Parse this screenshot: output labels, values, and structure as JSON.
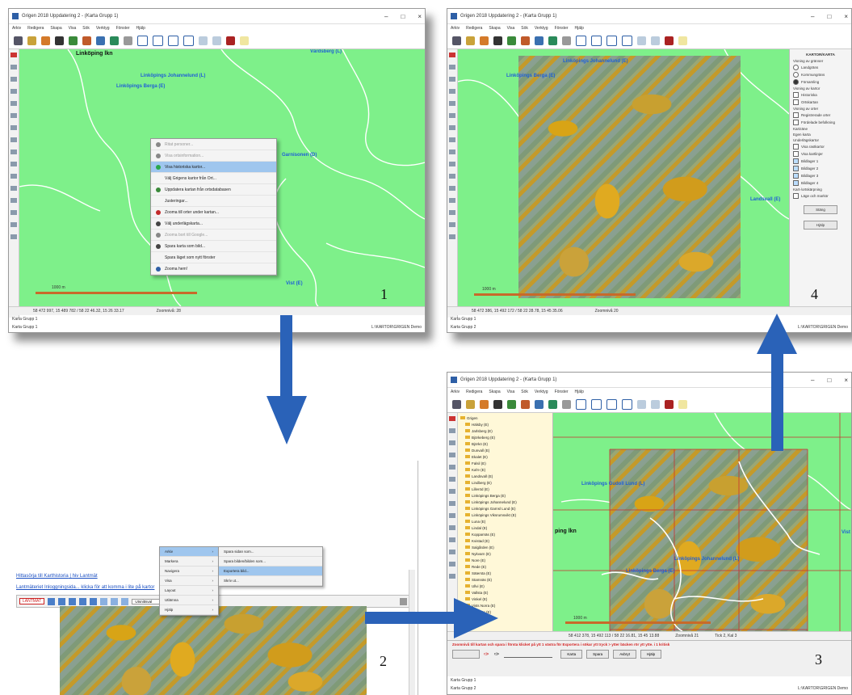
{
  "step_numbers": [
    "1",
    "2",
    "3",
    "4"
  ],
  "window_title": "Grigen 2018 Uppdatering 2 - (Karta Grupp 1)",
  "menu_items": [
    "Arkiv",
    "Redigera",
    "Skapa",
    "Visa",
    "Sök",
    "Verktyg",
    "Fönster",
    "Hjälp"
  ],
  "window_controls": {
    "minimize": "–",
    "maximize": "□",
    "close": "×"
  },
  "win1": {
    "places": [
      "Linköping lkn",
      "Linköpings Johannelund (L)",
      "Linköpings Berga (E)",
      "Värdsberg (L)",
      "Garnisonen (D)",
      "Vist (E)"
    ],
    "context_menu": [
      {
        "label": "Ritat personer...",
        "disabled": true,
        "selected": false,
        "color": "#888888"
      },
      {
        "label": "Visa ortsinformation...",
        "disabled": true,
        "selected": false,
        "color": "#888888"
      },
      {
        "label": "Visa historiska kartor...",
        "disabled": false,
        "selected": true,
        "color": "#2aa84a"
      },
      {
        "label": "Välj Grigens kartor från Ort...",
        "disabled": false,
        "selected": false,
        "color": ""
      },
      {
        "label": "Uppdatera kartan från ortsdatabasen",
        "disabled": false,
        "selected": false,
        "color": "#3a8a3a"
      },
      {
        "label": "Justeringar...",
        "disabled": false,
        "selected": false,
        "color": ""
      },
      {
        "label": "Zooma till orter under kartan...",
        "disabled": false,
        "selected": false,
        "color": "#c22a2a"
      },
      {
        "label": "Välj underlägskarta...",
        "disabled": false,
        "selected": false,
        "color": "#444444"
      },
      {
        "label": "Zooma bort till Google...",
        "disabled": true,
        "selected": false,
        "color": "#888888"
      },
      {
        "label": "Spara karta som bild...",
        "disabled": false,
        "selected": false,
        "color": "#444444"
      },
      {
        "label": "Spara läget som nytt fönster",
        "disabled": false,
        "selected": false,
        "color": ""
      },
      {
        "label": "Zooma hem!",
        "disabled": false,
        "selected": false,
        "color": "#2e5fa6"
      }
    ],
    "status": [
      "58 472 997, 15 489 782 / 58 22 46.32, 15 26 33.17",
      "Zoomnivå: 28"
    ],
    "bottom": [
      "Karta Grupp 1",
      "Karta Grupp 1",
      "L:\\KARTOR\\GRIGEN Demo"
    ],
    "scale": "1000 m"
  },
  "win2": {
    "links": [
      "Hittasörja till Karthistoria",
      "hiv Lantmät",
      "Lantmäteriet Inloggningsida... klicka för att komma i lite på kartor"
    ],
    "toolbar_label": "LANTMÄT",
    "zoom_select": "Utsnittsval",
    "menu": [
      {
        "label": "Arkiv",
        "selected": true
      },
      {
        "label": "Markera",
        "selected": false
      },
      {
        "label": "Navigera",
        "selected": false
      },
      {
        "label": "Visa",
        "selected": false
      },
      {
        "label": "Layout",
        "selected": false
      },
      {
        "label": "Utlämna",
        "selected": false
      },
      {
        "label": "Hjälp",
        "selected": false
      }
    ],
    "submenu": [
      {
        "label": "Spara sidan som...",
        "selected": false
      },
      {
        "label": "Spara bilden/bilden som...",
        "selected": false
      },
      {
        "label": "Exportera bild...",
        "selected": true
      },
      {
        "label": "Skriv ut...",
        "selected": false
      }
    ]
  },
  "win3": {
    "tree": [
      "Grigen",
      "Hälsby (E)",
      "Jarlsberg (E)",
      "Björkeberg (E)",
      "Björkö (E)",
      "Dunvall (E)",
      "Ekalet (E)",
      "Falsil (E)",
      "Kal'e (E)",
      "Landsvall (E)",
      "Lindberg (E)",
      "Lilleröd (E)",
      "Linköpings Berga (E)",
      "Linköpings Johannelund (E)",
      "Linköpings Garnsl Lund (E)",
      "Linköpings Viksrumsvikt (E)",
      "Luna (E)",
      "Lindal (E)",
      "Kopparnäs (E)",
      "Kvistad (E)",
      "Salgården (E)",
      "Nykvarn (E)",
      "Nore (E)",
      "Rede (E)",
      "Sätersta (E)",
      "Stamnäs (E)",
      "Ullvi (E)",
      "Vallsta (E)",
      "Vinkel (E)",
      "Vists Norra (E)",
      "Vårdnäs (E)"
    ],
    "places": [
      "Linköpings Gudoll Lund (L)",
      "Linköpings Johannelund (L)",
      "Linköpings Berga (E)",
      "ping lkn",
      "Vist"
    ],
    "status_line": "Zoomnivå till kartan och spara i första klicket på ytt 1 västra för Exportera i sökar ytt tryck > ytter bäcken rör ytt ytte. i 1 kritisk",
    "buttons": [
      "Karta",
      "Spara",
      "Avbryt",
      "Hjälp"
    ],
    "status": [
      "58 412 378, 15 492 113 / 58 22 16.81, 15 45 13.88",
      "Zoomnivå 21",
      "Tick 2, Kal 3"
    ],
    "bottom": [
      "Karta Grupp 1",
      "Karta Grupp 2",
      "L:\\KARTOR\\GRIGEN Demo"
    ],
    "scale": "1000 m"
  },
  "win4": {
    "places": [
      "Linköpings Johannelund (E)",
      "Linköpings Berga (E)",
      "Landsvall (E)"
    ],
    "panel": {
      "title": "KARTOR/KARTA",
      "sections": [
        {
          "heading": "Visning av gränser",
          "items": [
            "Landgräns",
            "Kommungräns",
            "Församling"
          ]
        },
        {
          "heading": "Visning av kartor",
          "items": [
            "Historiska",
            "Ortskartan"
          ]
        },
        {
          "heading": "Visning av orter",
          "items": [
            "Registrerade orter",
            "Fördelade befolkning"
          ]
        },
        {
          "heading": "Kartzäne",
          "items": [
            "Egen karta"
          ]
        },
        {
          "heading": "Underlägskartor",
          "items": [
            "Visa rastkartor",
            "Visa kartlinjer",
            "Bildlager 1",
            "Bildlager 2",
            "Bildlager 3",
            "Bildlager 4"
          ]
        },
        {
          "heading": "Kart-/ortskärpning",
          "items": [
            "Läge och markör"
          ]
        }
      ],
      "buttons": [
        "Stäng",
        "Hjälp"
      ]
    },
    "status": [
      "58 472 386, 15 492 172 / 58 22 28.78, 15 45 35.06",
      "Zoomnivå 20"
    ],
    "bottom": [
      "Karta Grupp 1",
      "Karta Grupp 2",
      "L:\\KARTOR\\GRIGEN Demo"
    ],
    "scale": "1000 m"
  },
  "colors": {
    "arrow": "#2a62b8",
    "map_green": "#7ef08a",
    "highlight": "#9fc6ee",
    "link_blue": "#1a4fc2"
  },
  "icons": [
    "down-arrow-icon",
    "right-arrow-icon",
    "up-arrow-icon"
  ]
}
